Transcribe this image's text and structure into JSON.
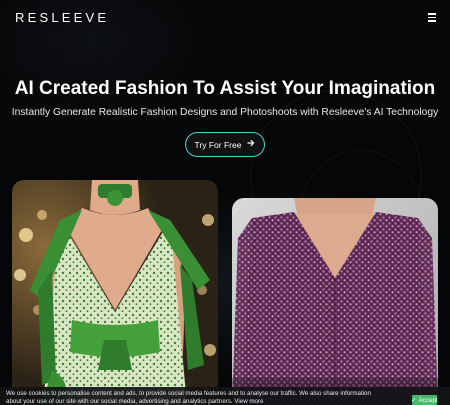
{
  "header": {
    "logo": "RESLEEVE",
    "menu_icon": "hamburger-menu-icon"
  },
  "hero": {
    "title": "AI Created Fashion To Assist Your Imagination",
    "subtitle": "Instantly Generate Realistic Fashion Designs and Photoshoots with Resleeve's AI Technology",
    "cta_label": "Try For Free",
    "cta_icon": "arrow-right-icon",
    "cta_border_color": "#4fd1c5"
  },
  "gallery": {
    "images": [
      {
        "subject": "green patterned dress with bow collar"
      },
      {
        "subject": "purple sequin v-neck blouse"
      }
    ]
  },
  "cookie_banner": {
    "text": "We use cookies to personalise content and ads, to provide social media features and to analyse our traffic. We also share information about your use of our site with our social media, advertising and analytics partners. View more",
    "accept_label": "Accept",
    "accept_color": "#49b86a"
  }
}
